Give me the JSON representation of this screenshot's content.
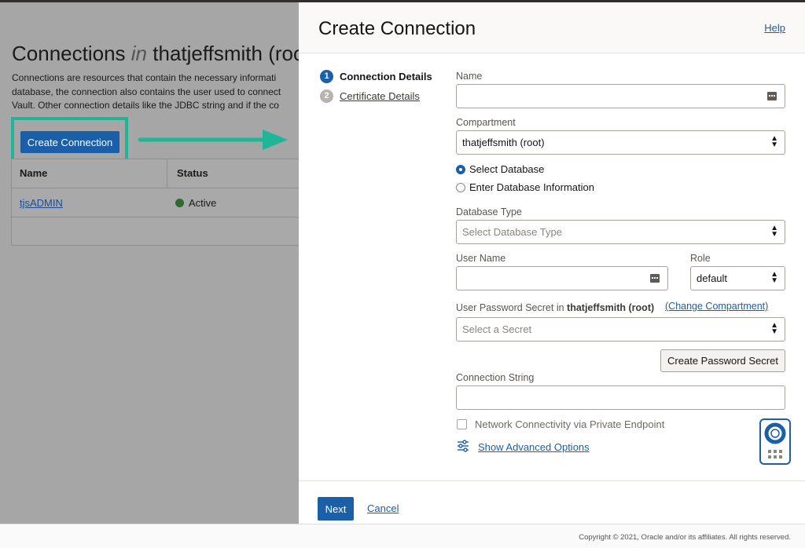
{
  "background": {
    "title_prefix": "Connections",
    "title_in": "in",
    "title_compartment": "thatjeffsmith (roo",
    "description_lines": [
      "Connections are resources that contain the necessary informati",
      "database, the connection also contains the user used to connect",
      "Vault. Other connection details like the JDBC string and if the co"
    ],
    "create_button": "Create Connection",
    "table": {
      "headers": [
        "Name",
        "Status"
      ],
      "rows": [
        {
          "name": "tjsADMIN",
          "status": "Active"
        }
      ]
    }
  },
  "panel": {
    "title": "Create Connection",
    "help": "Help",
    "steps": [
      {
        "num": "1",
        "label": "Connection Details"
      },
      {
        "num": "2",
        "label": "Certificate Details"
      }
    ],
    "form": {
      "name_label": "Name",
      "name_value": "",
      "compartment_label": "Compartment",
      "compartment_value": "thatjeffsmith (root)",
      "radio_select_db": "Select Database",
      "radio_enter_db": "Enter Database Information",
      "db_type_label": "Database Type",
      "db_type_placeholder": "Select Database Type",
      "username_label": "User Name",
      "username_value": "",
      "role_label": "Role",
      "role_value": "default",
      "secret_label_prefix": "User Password Secret in",
      "secret_label_compartment": "thatjeffsmith (root)",
      "change_compartment": "(Change Compartment)",
      "secret_placeholder": "Select a Secret",
      "create_secret_button": "Create Password Secret",
      "conn_string_label": "Connection String",
      "conn_string_value": "",
      "private_endpoint_label": "Network Connectivity via Private Endpoint",
      "advanced_options": "Show Advanced Options"
    },
    "footer": {
      "next": "Next",
      "cancel": "Cancel"
    }
  },
  "copyright": "Copyright © 2021, Oracle and/or its affiliates. All rights reserved.",
  "colors": {
    "accent": "#1a5fa8",
    "annotation": "#1fb597",
    "active_status": "#2f6a31"
  }
}
